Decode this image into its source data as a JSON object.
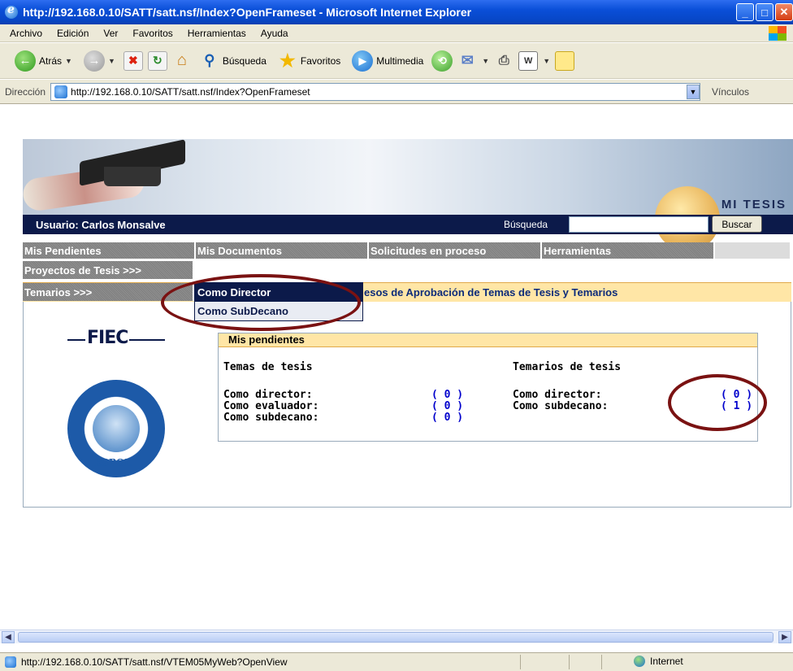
{
  "window": {
    "title": "http://192.168.0.10/SATT/satt.nsf/Index?OpenFrameset - Microsoft Internet Explorer"
  },
  "menu": [
    "Archivo",
    "Edición",
    "Ver",
    "Favoritos",
    "Herramientas",
    "Ayuda"
  ],
  "toolbar": {
    "back": "Atrás",
    "search": "Búsqueda",
    "favorites": "Favoritos",
    "media": "Multimedia"
  },
  "address": {
    "label": "Dirección",
    "url": "http://192.168.0.10/SATT/satt.nsf/Index?OpenFrameset",
    "links": "Vínculos"
  },
  "banner": {
    "brand": "MI TESIS"
  },
  "userbar": {
    "user": "Usuario: Carlos Monsalve",
    "search_label": "Búsqueda",
    "search_button": "Buscar"
  },
  "nav": {
    "tabs": [
      "Mis Pendientes",
      "Mis Documentos",
      "Solicitudes en proceso",
      "Herramientas"
    ],
    "proyectos": "Proyectos de Tesis >>>",
    "temarios": "Temarios >>>",
    "submenu": [
      "Como Director",
      "Como SubDecano"
    ]
  },
  "content": {
    "heading": "esos de Aprobación de Temas de Tesis y Temarios",
    "logo_fiec": "FIEC",
    "logo_espol": "ESPOL",
    "pendientes": {
      "title": "Mis pendientes",
      "temas_title": "Temas de tesis",
      "temarios_title": "Temarios de tesis",
      "temas": [
        {
          "label": "Como director:",
          "value": "( 0 )"
        },
        {
          "label": "Como evaluador:",
          "value": "( 0 )"
        },
        {
          "label": "Como subdecano:",
          "value": "( 0 )"
        }
      ],
      "temarios": [
        {
          "label": "Como director:",
          "value": "( 0 )"
        },
        {
          "label": "Como subdecano:",
          "value": "( 1 )"
        }
      ]
    }
  },
  "status": {
    "url": "http://192.168.0.10/SATT/satt.nsf/VTEM05MyWeb?OpenView",
    "zone": "Internet"
  },
  "colors": {
    "navy": "#0c1a4a",
    "highlight": "#ffe6a6",
    "annotation": "#7a1212"
  }
}
